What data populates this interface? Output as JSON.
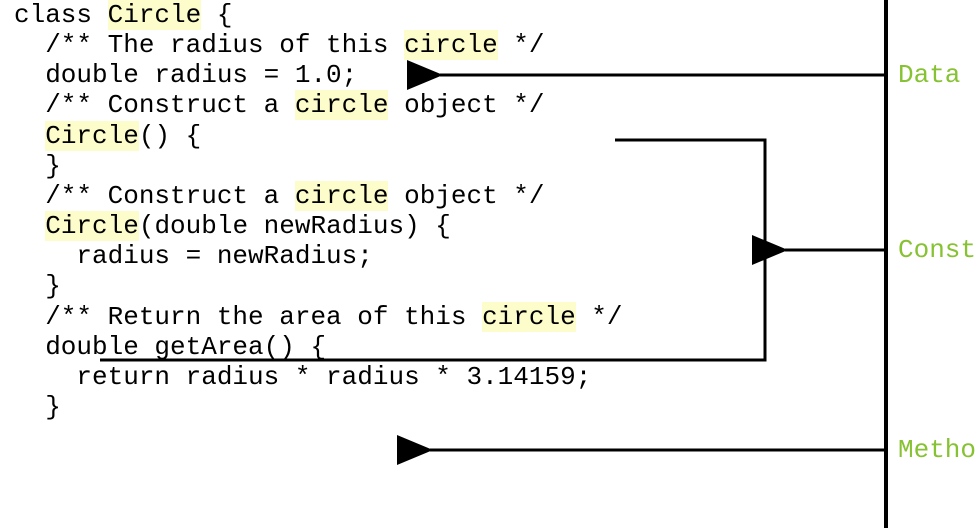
{
  "code": {
    "line1_a": "class ",
    "line1_b": "Circle",
    "line1_c": " {",
    "line2_a": "  /** The radius of this ",
    "line2_b": "circle",
    "line2_c": " */",
    "line3": "  double radius = 1.0;",
    "line4": "",
    "line5_a": "  /** Construct a ",
    "line5_b": "circle",
    "line5_c": " object */",
    "line6_a": "  ",
    "line6_b": "Circle",
    "line6_c": "() {",
    "line7": "  }",
    "line8": "",
    "line9_a": "  /** Construct a ",
    "line9_b": "circle",
    "line9_c": " object */",
    "line10_a": "  ",
    "line10_b": "Circle",
    "line10_c": "(double newRadius) {",
    "line11": "    radius = newRadius;",
    "line12": "  }",
    "line13": "",
    "line14_a": "  /** Return the area of this ",
    "line14_b": "circle",
    "line14_c": " */",
    "line15": "  double getArea() {",
    "line16": "    return radius * radius * 3.14159;",
    "line17": "  }"
  },
  "labels": {
    "data": "Data",
    "constructors": "Const",
    "method": "Metho"
  }
}
